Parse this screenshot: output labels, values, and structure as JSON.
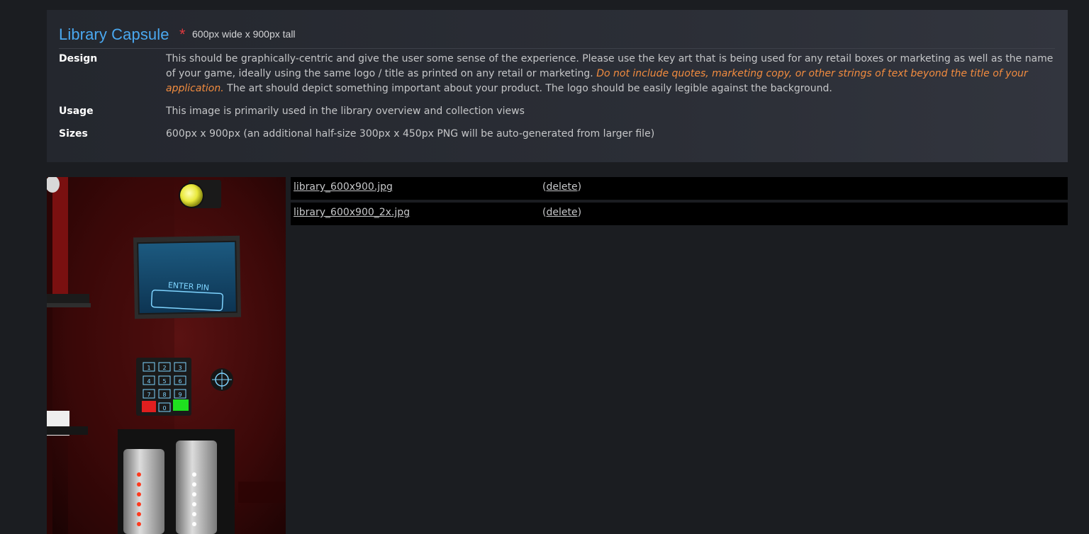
{
  "asset": {
    "title": "Library Capsule",
    "required_mark": "*",
    "dimensions_note": "600px wide x 900px tall"
  },
  "rows": {
    "design": {
      "label": "Design",
      "text_before": "This should be graphically-centric and give the user some sense of the experience. Please use the key art that is being used for any retail boxes or marketing as well as the name of your game, ideally using the same logo / title as printed on any retail or marketing.",
      "warning": "Do not include quotes, marketing copy, or other strings of text beyond the title of your application.",
      "text_after": "The art should depict something important about your product. The logo should be easily legible against the background."
    },
    "usage": {
      "label": "Usage",
      "text": "This image is primarily used in the library overview and collection views"
    },
    "sizes": {
      "label": "Sizes",
      "text": "600px x 900px (an additional half-size 300px x 450px PNG will be auto-generated from larger file)"
    }
  },
  "preview": {
    "screen_text": "ENTER PIN",
    "keypad": [
      "1",
      "2",
      "3",
      "4",
      "5",
      "6",
      "7",
      "8",
      "9",
      "0"
    ]
  },
  "files": [
    {
      "name": "library_600x900.jpg",
      "open_paren": "(",
      "delete_label": "delete",
      "close_paren": ")"
    },
    {
      "name": "library_600x900_2x.jpg",
      "open_paren": "(",
      "delete_label": "delete",
      "close_paren": ")"
    }
  ],
  "colors": {
    "title": "#4aa8f0",
    "required": "#e0393e",
    "warning": "#f38c3f",
    "background": "#1b1d21"
  }
}
